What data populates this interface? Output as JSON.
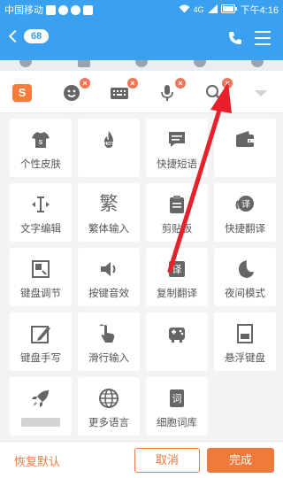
{
  "status_bar": {
    "carrier": "中国移动",
    "signal_text": "4G",
    "time": "下午4:16"
  },
  "chat_bar": {
    "unread_count": "68",
    "icons": [
      "back-icon",
      "phone-icon",
      "menu-icon"
    ]
  },
  "keyboard_toolbar": {
    "logo_text": "S",
    "items": [
      {
        "icon": "emoji-icon",
        "removable": true
      },
      {
        "icon": "keyboard-icon",
        "removable": true
      },
      {
        "icon": "microphone-icon",
        "removable": true
      },
      {
        "icon": "search-icon",
        "removable": true
      }
    ],
    "remove_glyph": "×"
  },
  "tools": [
    {
      "label": "个性皮肤",
      "icon": "tshirt-icon"
    },
    {
      "label": "",
      "icon": "hot-flame-icon"
    },
    {
      "label": "快捷短语",
      "icon": "message-icon"
    },
    {
      "label": "",
      "icon": "wallet-icon"
    },
    {
      "label": "文字编辑",
      "icon": "cursor-icon"
    },
    {
      "label": "繁体输入",
      "icon": "traditional-char-icon",
      "glyph": "繁"
    },
    {
      "label": "剪贴板",
      "icon": "clipboard-icon"
    },
    {
      "label": "快捷翻译",
      "icon": "translate-bubble-icon",
      "glyph": "译"
    },
    {
      "label": "键盘调节",
      "icon": "resize-icon"
    },
    {
      "label": "按键音效",
      "icon": "speaker-icon"
    },
    {
      "label": "复制翻译",
      "icon": "copy-translate-icon",
      "glyph": "译"
    },
    {
      "label": "夜间模式",
      "icon": "moon-icon"
    },
    {
      "label": "键盘手写",
      "icon": "pen-icon"
    },
    {
      "label": "滑行输入",
      "icon": "swipe-hand-icon"
    },
    {
      "label": "",
      "icon": "game-controller-icon"
    },
    {
      "label": "悬浮键盘",
      "icon": "floating-keyboard-icon"
    },
    {
      "label": "",
      "icon": "rocket-icon"
    },
    {
      "label": "更多语言",
      "icon": "globe-icon"
    },
    {
      "label": "细胞词库",
      "icon": "dictionary-icon",
      "glyph": "词"
    }
  ],
  "footer": {
    "restore_label": "恢复默认",
    "cancel_label": "取消",
    "done_label": "完成"
  },
  "colors": {
    "blue": "#3aa0f0",
    "orange": "#f07a3c",
    "icon_gray": "#666666",
    "annotation_red": "#e8202a"
  }
}
